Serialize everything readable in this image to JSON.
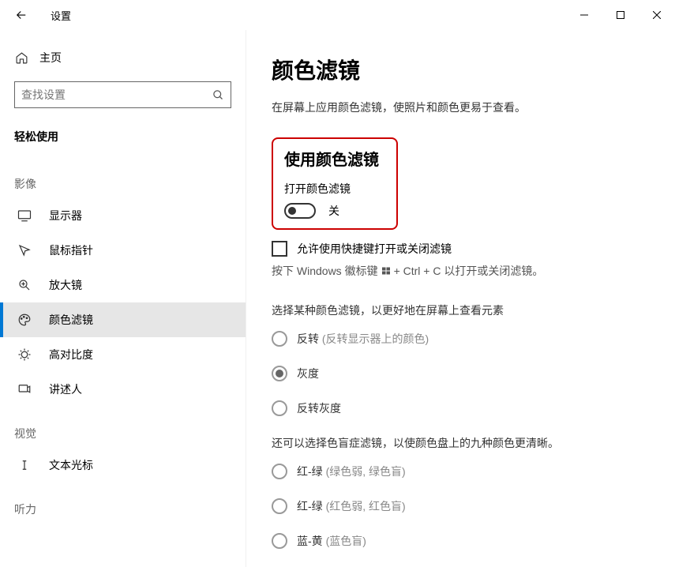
{
  "titlebar": {
    "title": "设置"
  },
  "sidebar": {
    "home_label": "主页",
    "search_placeholder": "查找设置",
    "section": "轻松使用",
    "groups": [
      {
        "title": "影像",
        "items": [
          {
            "id": "display",
            "label": "显示器"
          },
          {
            "id": "cursor",
            "label": "鼠标指针"
          },
          {
            "id": "magnifier",
            "label": "放大镜"
          },
          {
            "id": "color-filters",
            "label": "颜色滤镜",
            "selected": true
          },
          {
            "id": "high-contrast",
            "label": "高对比度"
          },
          {
            "id": "narrator",
            "label": "讲述人"
          }
        ]
      },
      {
        "title": "视觉",
        "items": [
          {
            "id": "text-cursor",
            "label": "文本光标"
          }
        ]
      },
      {
        "title": "听力",
        "items": []
      }
    ]
  },
  "main": {
    "title": "颜色滤镜",
    "subtitle": "在屏幕上应用颜色滤镜，使照片和颜色更易于查看。",
    "use_filter_heading": "使用颜色滤镜",
    "toggle_label": "打开颜色滤镜",
    "toggle_state": "关",
    "shortcut_checkbox_label": "允许使用快捷键打开或关闭滤镜",
    "shortcut_hint_prefix": "按下 Windows 徽标键",
    "shortcut_hint_suffix": "+ Ctrl + C 以打开或关闭滤镜。",
    "filter_desc": "选择某种颜色滤镜，以更好地在屏幕上查看元素",
    "filters": [
      {
        "label": "反转",
        "sub": "(反转显示器上的颜色)"
      },
      {
        "label": "灰度",
        "sub": "",
        "selected": true
      },
      {
        "label": "反转灰度",
        "sub": ""
      }
    ],
    "colorblind_desc": "还可以选择色盲症滤镜，以使颜色盘上的九种颜色更清晰。",
    "colorblind_filters": [
      {
        "label": "红-绿",
        "sub": "(绿色弱, 绿色盲)"
      },
      {
        "label": "红-绿",
        "sub": "(红色弱, 红色盲)"
      },
      {
        "label": "蓝-黄",
        "sub": "(蓝色盲)"
      }
    ]
  }
}
